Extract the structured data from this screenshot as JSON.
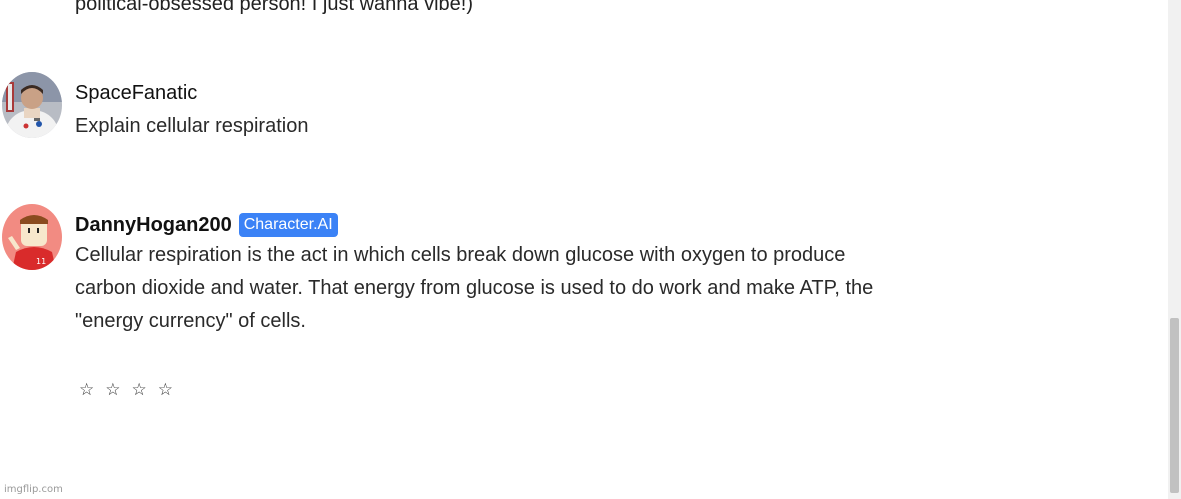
{
  "previous_message": {
    "text": "political-obsessed person! I just wanna vibe!)"
  },
  "messages": [
    {
      "username": "SpaceFanatic",
      "avatar_icon": "astronaut-avatar-icon",
      "lines": [
        "Explain cellular respiration"
      ]
    },
    {
      "username": "DannyHogan200",
      "badge": "Character.AI",
      "avatar_icon": "cartoon-character-avatar-icon",
      "lines": [
        "Cellular respiration is the act in which cells break down glucose with oxygen to produce",
        "carbon dioxide and water. That energy from glucose is used to do work and make ATP, the",
        "\"energy currency\" of cells."
      ],
      "rating": {
        "stars": [
          "☆",
          "☆",
          "☆",
          "☆"
        ],
        "selected": 0
      }
    }
  ],
  "watermark": "imgflip.com",
  "colors": {
    "badge": "#3b82f6",
    "avatar_bg": "#f28b82"
  }
}
